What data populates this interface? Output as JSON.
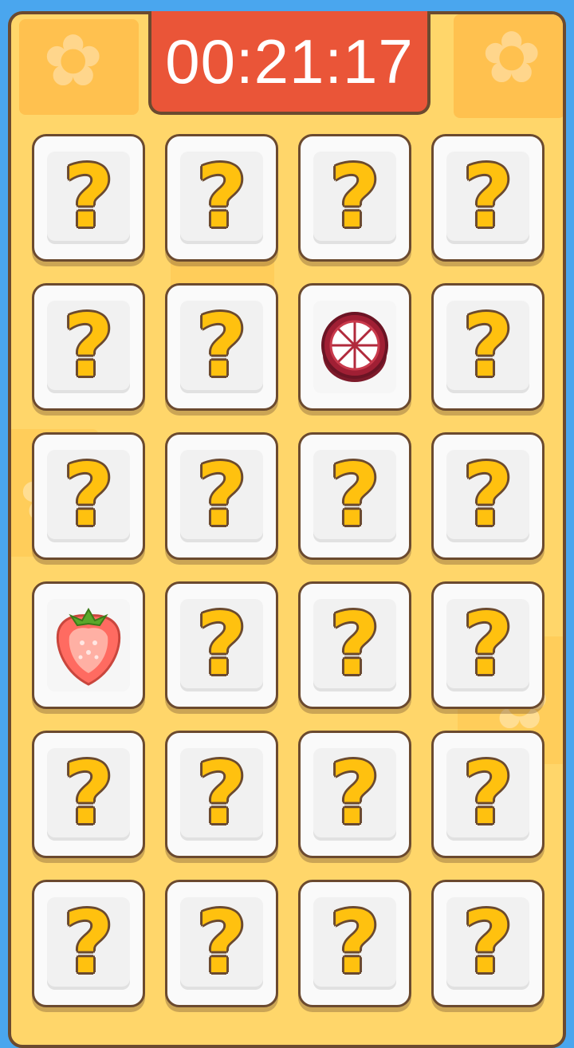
{
  "timer": {
    "text": "00:21:17"
  },
  "colors": {
    "background": "#4aa6ee",
    "board": "#ffd66a",
    "timer": "#ea5538",
    "question_mark": "#ffc10f",
    "border": "#6b4a2f"
  },
  "cards": [
    {
      "state": "hidden",
      "symbol": "?"
    },
    {
      "state": "hidden",
      "symbol": "?"
    },
    {
      "state": "hidden",
      "symbol": "?"
    },
    {
      "state": "hidden",
      "symbol": "?"
    },
    {
      "state": "hidden",
      "symbol": "?"
    },
    {
      "state": "hidden",
      "symbol": "?"
    },
    {
      "state": "revealed",
      "fruit": "mangosteen-icon"
    },
    {
      "state": "hidden",
      "symbol": "?"
    },
    {
      "state": "hidden",
      "symbol": "?"
    },
    {
      "state": "hidden",
      "symbol": "?"
    },
    {
      "state": "hidden",
      "symbol": "?"
    },
    {
      "state": "hidden",
      "symbol": "?"
    },
    {
      "state": "revealed",
      "fruit": "strawberry-icon"
    },
    {
      "state": "hidden",
      "symbol": "?"
    },
    {
      "state": "hidden",
      "symbol": "?"
    },
    {
      "state": "hidden",
      "symbol": "?"
    },
    {
      "state": "hidden",
      "symbol": "?"
    },
    {
      "state": "hidden",
      "symbol": "?"
    },
    {
      "state": "hidden",
      "symbol": "?"
    },
    {
      "state": "hidden",
      "symbol": "?"
    },
    {
      "state": "hidden",
      "symbol": "?"
    },
    {
      "state": "hidden",
      "symbol": "?"
    },
    {
      "state": "hidden",
      "symbol": "?"
    },
    {
      "state": "hidden",
      "symbol": "?"
    }
  ]
}
